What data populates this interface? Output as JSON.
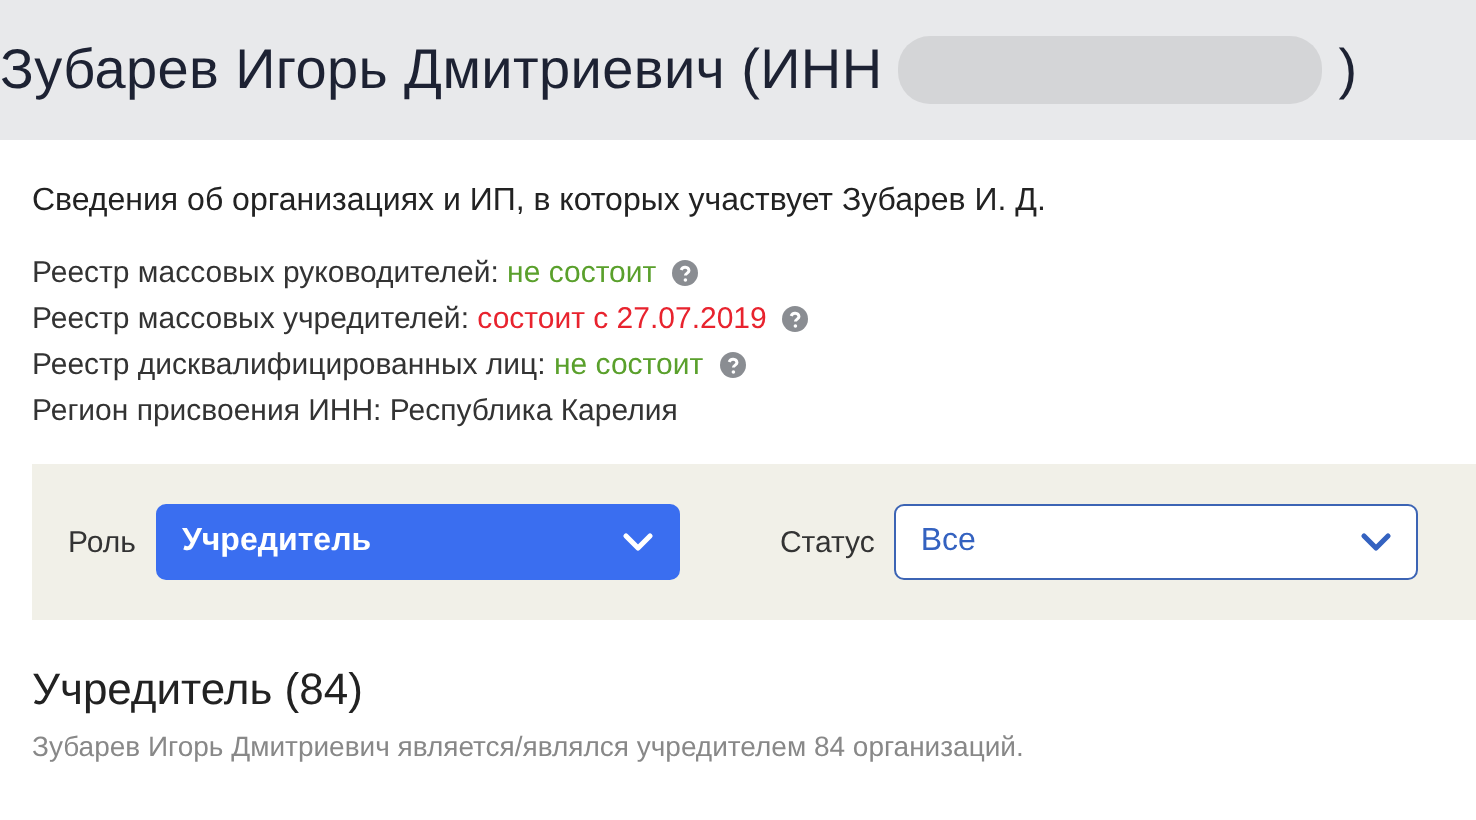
{
  "header": {
    "title": "Зубарев Игорь Дмитриевич (ИНН",
    "title_end": ")"
  },
  "subtitle": "Сведения об организациях и ИП, в которых участвует Зубарев И. Д.",
  "registries": [
    {
      "label": "Реестр массовых руководителей:",
      "value": "не состоит",
      "kind": "negative",
      "help": true
    },
    {
      "label": "Реестр массовых учредителей:",
      "value": "состоит с 27.07.2019",
      "kind": "positive",
      "help": true
    },
    {
      "label": "Реестр дисквалифицированных лиц:",
      "value": "не состоит",
      "kind": "negative",
      "help": true
    },
    {
      "label": "Регион присвоения ИНН: Республика Карелия",
      "kind": "plain",
      "help": false
    }
  ],
  "filters": [
    {
      "label": "Роль",
      "value": "Учредитель",
      "active": true
    },
    {
      "label": "Статус",
      "value": "Все",
      "active": false
    }
  ],
  "section": {
    "heading": "Учредитель (84)",
    "description": "Зубарев Игорь Дмитриевич является/являлся учредителем 84 организаций."
  }
}
